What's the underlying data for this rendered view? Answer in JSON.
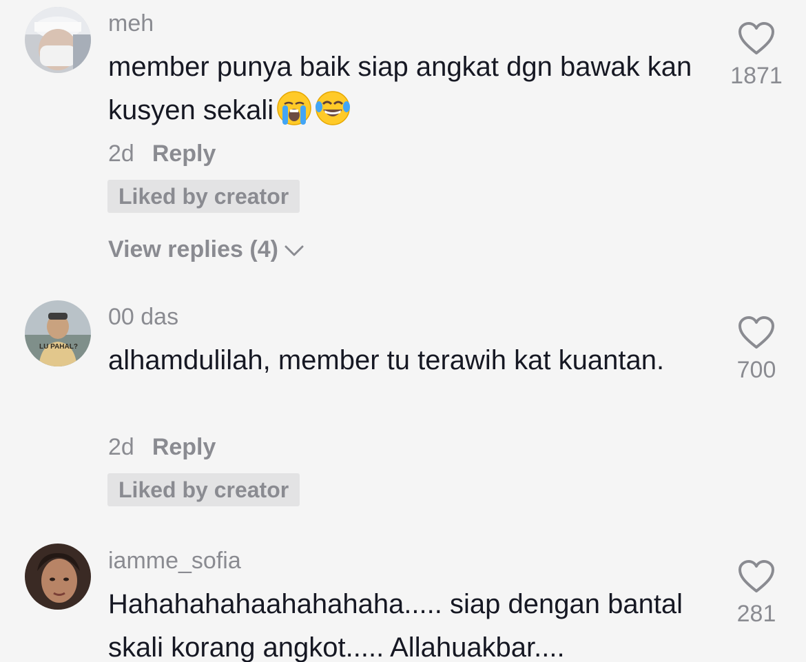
{
  "comments": [
    {
      "username": "meh",
      "text": "member punya baik siap angkat dgn bawak kan kusyen sekali",
      "emojis": [
        "crying-face-emoji",
        "tears-of-joy-emoji"
      ],
      "time": "2d",
      "reply_label": "Reply",
      "badge": "Liked by creator",
      "view_replies": "View replies (4)",
      "likes": "1871"
    },
    {
      "username": "00 das",
      "text": "alhamdulilah, member tu terawih kat kuantan.",
      "time": "2d",
      "reply_label": "Reply",
      "badge": "Liked by creator",
      "likes": "700",
      "avatar_caption": "LU PAHAL?"
    },
    {
      "username": "iamme_sofia",
      "text": "Hahahahahaahahahaha..... siap dengan bantal skali korang angkot..... Allahuakbar....",
      "likes": "281"
    }
  ]
}
